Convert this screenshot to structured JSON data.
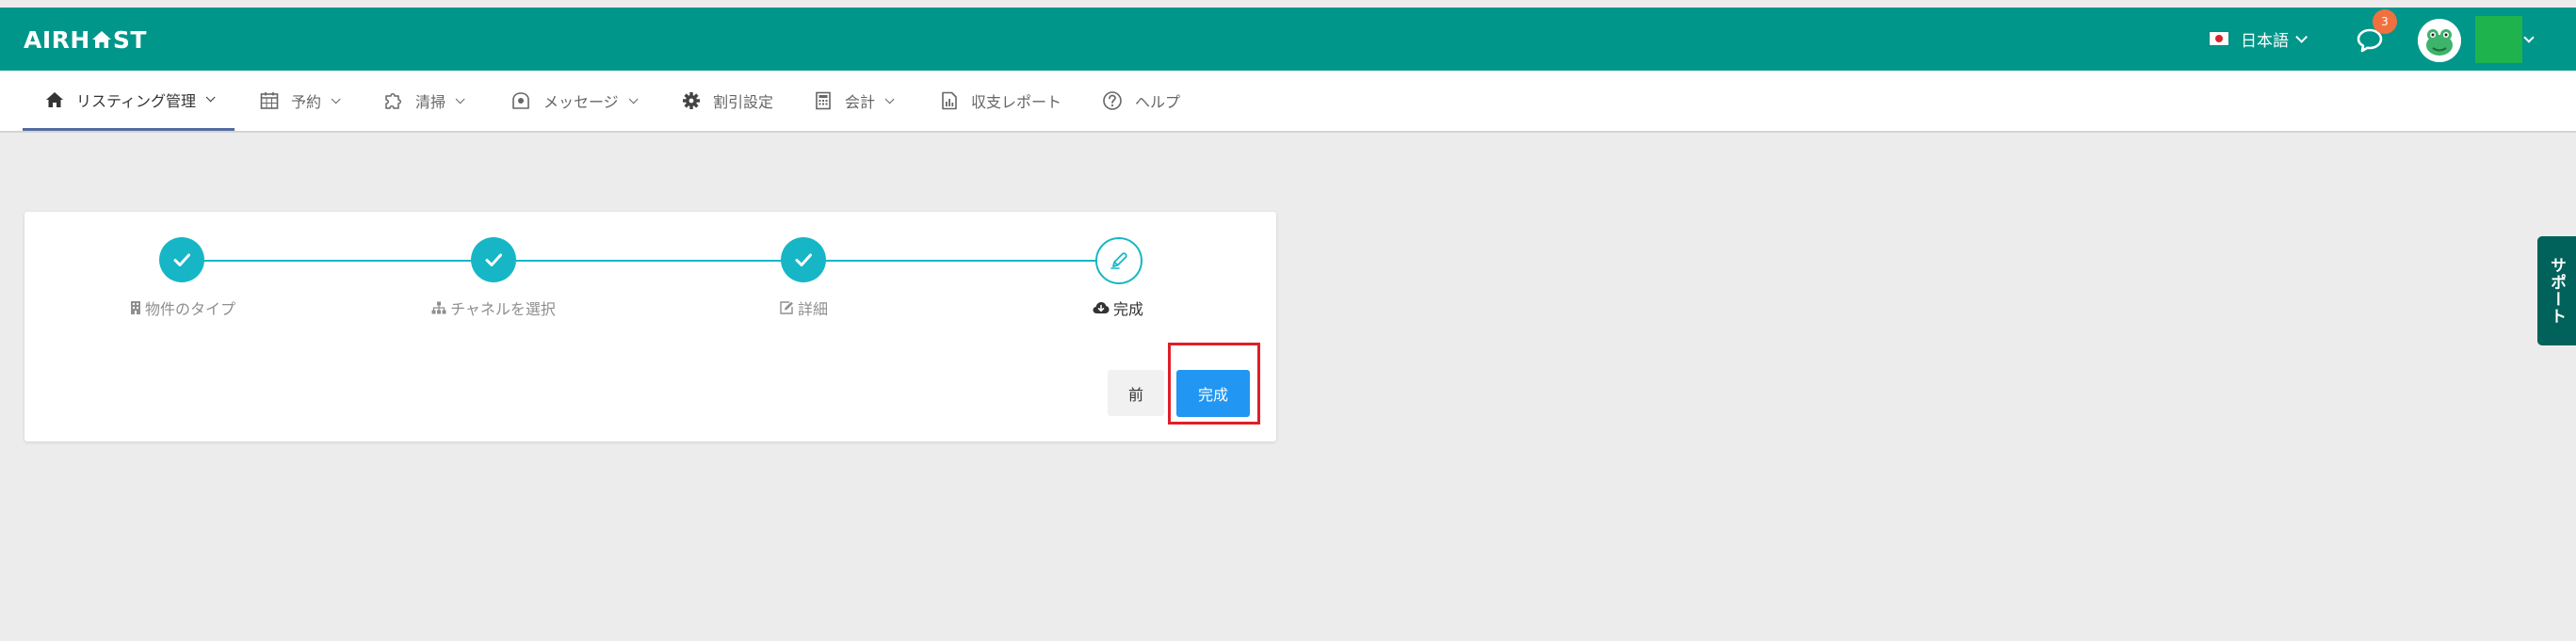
{
  "header": {
    "logo_text_left": "AIRH",
    "logo_text_right": "ST",
    "language": "日本語",
    "notification_count": "3"
  },
  "nav": {
    "items": [
      {
        "label": "リスティング管理",
        "icon": "home-icon",
        "active": true
      },
      {
        "label": "予約",
        "icon": "calendar-icon"
      },
      {
        "label": "清掃",
        "icon": "puzzle-icon"
      },
      {
        "label": "メッセージ",
        "icon": "message-icon"
      },
      {
        "label": "割引設定",
        "icon": "gear-icon"
      },
      {
        "label": "会計",
        "icon": "calculator-icon"
      },
      {
        "label": "収支レポート",
        "icon": "report-icon"
      },
      {
        "label": "ヘルプ",
        "icon": "help-icon"
      }
    ]
  },
  "wizard": {
    "steps": [
      {
        "label": "物件のタイプ",
        "icon": "building-icon",
        "status": "done"
      },
      {
        "label": "チャネルを選択",
        "icon": "sitemap-icon",
        "status": "done"
      },
      {
        "label": "詳細",
        "icon": "edit-icon",
        "status": "done"
      },
      {
        "label": "完成",
        "icon": "cloud-download-icon",
        "status": "current"
      }
    ],
    "prev_label": "前",
    "finish_label": "完成"
  },
  "support": {
    "label": "サポート"
  },
  "colors": {
    "header": "#00968a",
    "step": "#16b6c7",
    "primary_button": "#2196f3",
    "highlight": "#e11e26",
    "support_tab": "#00625b",
    "badge": "#f0713f"
  }
}
